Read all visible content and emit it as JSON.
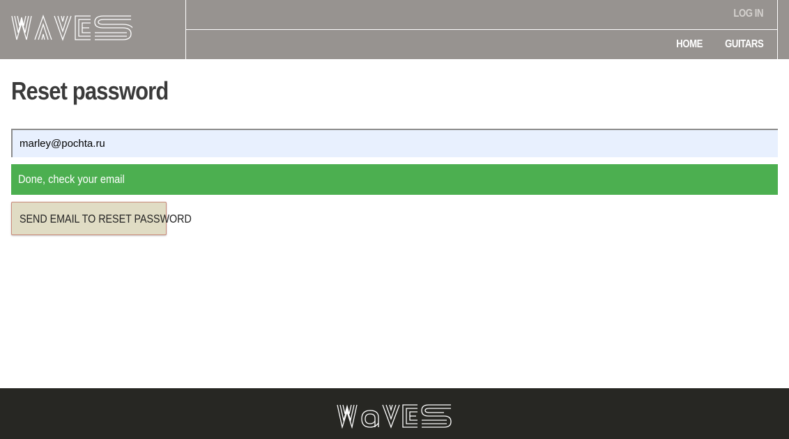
{
  "header": {
    "logo_text": "WAVES",
    "login_label": "LOG IN",
    "nav": [
      {
        "label": "HOME"
      },
      {
        "label": "GUITARS"
      }
    ]
  },
  "main": {
    "title": "Reset password",
    "email_field": {
      "value": "marley@pochta.ru",
      "placeholder": ""
    },
    "success_message": "Done, check your email",
    "submit_label": "SEND EMAIL TO RESET PASSWORD"
  },
  "footer": {
    "logo_text": "Waves"
  },
  "colors": {
    "header_bg": "#979390",
    "footer_bg": "#272723",
    "success_bg": "#4caf50",
    "input_bg": "#e8f0fe",
    "button_bg": "#e0dcc4"
  }
}
